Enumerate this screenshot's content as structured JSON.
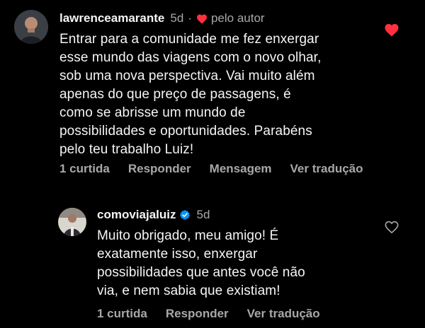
{
  "comments": [
    {
      "username": "lawrenceamarante",
      "time": "5d",
      "separator": "·",
      "author_like_label": "pelo autor",
      "text_lines": [
        "Entrar para a comunidade me fez enxergar",
        "esse mundo das viagens com o novo olhar,",
        "sob uma nova perspectiva. Vai muito além",
        "apenas do que preço de passagens, é",
        "como se abrisse um mundo de",
        "possibilidades e oportunidades. Parabéns",
        "pelo teu trabalho Luiz!"
      ],
      "actions": {
        "likes": "1 curtida",
        "reply": "Responder",
        "message": "Mensagem",
        "translate": "Ver tradução"
      },
      "liked": true,
      "like_icon": "heart-filled-icon"
    },
    {
      "username": "comoviajaluiz",
      "verified_icon": "verified-badge-icon",
      "time": "5d",
      "text_lines": [
        "Muito obrigado, meu amigo! É",
        "exatamente isso, enxergar",
        "possibilidades que antes você não",
        "via, e nem sabia que existiam!"
      ],
      "actions": {
        "likes": "1 curtida",
        "reply": "Responder",
        "translate": "Ver tradução"
      },
      "liked": false,
      "like_icon": "heart-outline-icon"
    }
  ],
  "colors": {
    "background": "#000000",
    "primary_text": "#f5f5f5",
    "secondary_text": "#a8a8a8",
    "like_red": "#ff3040",
    "verified_blue": "#0095f6"
  }
}
